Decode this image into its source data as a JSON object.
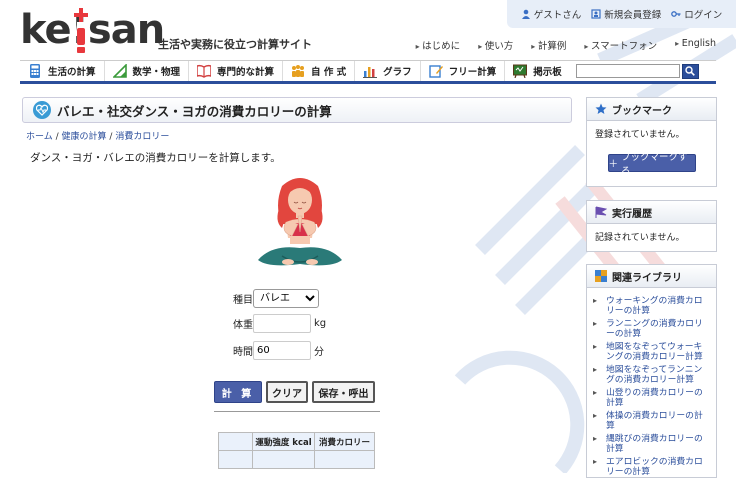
{
  "header": {
    "logo_text": "ke!san",
    "tagline": "生活や実務に役立つ計算サイト",
    "userbar": {
      "guest": "ゲストさん",
      "register": "新規会員登録",
      "login": "ログイン"
    },
    "topnav": [
      "はじめに",
      "使い方",
      "計算例",
      "スマートフォン",
      "English"
    ]
  },
  "mainnav": {
    "items": [
      {
        "label": "生活の計算",
        "icon": "calculator-icon",
        "color": "#3a7fd0"
      },
      {
        "label": "数学・物理",
        "icon": "triangle-ruler-icon",
        "color": "#3c9b3c"
      },
      {
        "label": "専門的な計算",
        "icon": "book-icon",
        "color": "#d24040"
      },
      {
        "label": "自 作 式",
        "icon": "people-icon",
        "color": "#e6a020"
      },
      {
        "label": "グラフ",
        "icon": "bar-chart-icon",
        "color": "#3a7fd0"
      },
      {
        "label": "フリー計算",
        "icon": "pencil-note-icon",
        "color": "#3a7fd0"
      },
      {
        "label": "掲示板",
        "icon": "board-icon",
        "color": "#3c9b3c"
      }
    ],
    "search_value": ""
  },
  "page": {
    "title": "バレエ・社交ダンス・ヨガの消費カロリーの計算",
    "breadcrumb": [
      "ホーム",
      "健康の計算",
      "消費カロリー"
    ],
    "intro": "ダンス・ヨガ・バレエの消費カロリーを計算します。"
  },
  "form": {
    "type_label": "種目",
    "type_value": "バレエ",
    "weight_label": "体重",
    "weight_value": "",
    "weight_unit": "kg",
    "time_label": "時間",
    "time_value": "60",
    "time_unit": "分"
  },
  "buttons": {
    "calc": "計 算",
    "clear": "クリア",
    "save": "保存・呼出"
  },
  "result_table": {
    "headers": [
      "",
      "運動強度 kcal",
      "消費カロリー"
    ]
  },
  "sidebar": {
    "bookmark": {
      "title": "ブックマーク",
      "empty": "登録されていません。",
      "button": "ブックマークする"
    },
    "history": {
      "title": "実行履歴",
      "empty": "記録されていません。"
    },
    "library": {
      "title": "関連ライブラリ",
      "items": [
        "ウォーキングの消費カロリーの計算",
        "ランニングの消費カロリーの計算",
        "地図をなぞってウォーキングの消費カロリー計算",
        "地図をなぞってランニングの消費カロリー計算",
        "山登りの消費カロリーの計算",
        "体操の消費カロリーの計算",
        "縄跳びの消費カロリーの計算",
        "エアロビックの消費カロリーの計算"
      ]
    }
  }
}
